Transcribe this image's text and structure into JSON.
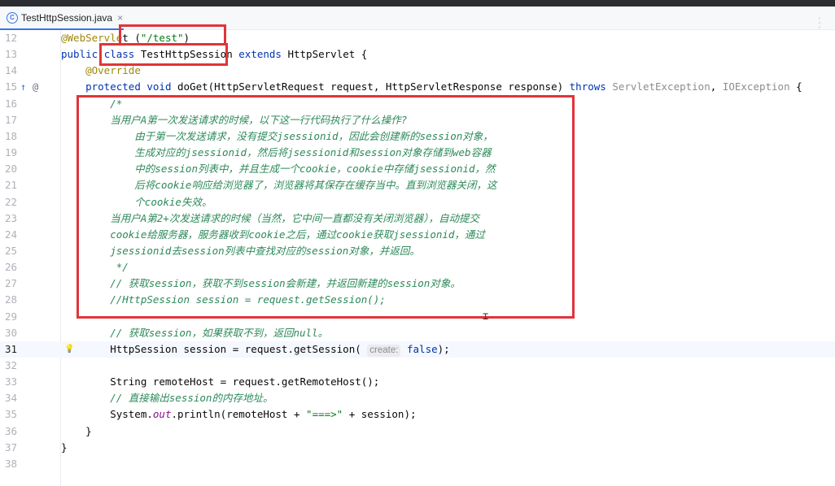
{
  "tab": {
    "filename": "TestHttpSession.java",
    "close": "×",
    "icon_letter": "C"
  },
  "lines": [
    {
      "n": "12",
      "parts": [
        [
          "ann",
          "@WebServle"
        ],
        [
          "",
          "t "
        ],
        [
          "",
          "("
        ],
        [
          "str",
          "\"/test\""
        ],
        [
          "",
          ")"
        ]
      ]
    },
    {
      "n": "13",
      "parts": [
        [
          "kw",
          "public "
        ],
        [
          "kw",
          "class "
        ],
        [
          "",
          "TestHttpSession "
        ],
        [
          "kw",
          "extends "
        ],
        [
          "",
          "HttpServlet {"
        ]
      ]
    },
    {
      "n": "14",
      "parts": [
        [
          "",
          "    "
        ],
        [
          "ann",
          "@Override"
        ]
      ]
    },
    {
      "n": "15",
      "parts": [
        [
          "",
          "    "
        ],
        [
          "kw",
          "protected void "
        ],
        [
          "",
          "doGet(HttpServletRequest request, HttpServletResponse response) "
        ],
        [
          "kw",
          "throws "
        ],
        [
          "gray",
          "ServletException"
        ],
        [
          "",
          ", "
        ],
        [
          "gray",
          "IOException"
        ],
        [
          "",
          " {"
        ]
      ]
    },
    {
      "n": "16",
      "parts": [
        [
          "cm",
          "        /*"
        ]
      ]
    },
    {
      "n": "17",
      "parts": [
        [
          "cm",
          "        当用户A第一次发送请求的时候，以下这一行代码执行了什么操作?"
        ]
      ]
    },
    {
      "n": "18",
      "parts": [
        [
          "cm",
          "            由于第一次发送请求，没有提交jsessionid，因此会创建新的session对象，"
        ]
      ]
    },
    {
      "n": "19",
      "parts": [
        [
          "cm",
          "            生成对应的jsessionid，然后将jsessionid和session对象存储到web容器"
        ]
      ]
    },
    {
      "n": "20",
      "parts": [
        [
          "cm",
          "            中的session列表中，并且生成一个cookie，cookie中存储jsessionid，然"
        ]
      ]
    },
    {
      "n": "21",
      "parts": [
        [
          "cm",
          "            后将cookie响应给浏览器了，浏览器将其保存在缓存当中。直到浏览器关闭，这"
        ]
      ]
    },
    {
      "n": "22",
      "parts": [
        [
          "cm",
          "            个cookie失效。"
        ]
      ]
    },
    {
      "n": "23",
      "parts": [
        [
          "cm",
          "        当用户A第2+次发送请求的时候（当然，它中间一直都没有关闭浏览器），自动提交"
        ]
      ]
    },
    {
      "n": "24",
      "parts": [
        [
          "cm",
          "        cookie给服务器，服务器收到cookie之后，通过cookie获取jsessionid，通过"
        ]
      ]
    },
    {
      "n": "25",
      "parts": [
        [
          "cm",
          "        jsessionid去session列表中查找对应的session对象，并返回。"
        ]
      ]
    },
    {
      "n": "26",
      "parts": [
        [
          "cm",
          "         */"
        ]
      ]
    },
    {
      "n": "27",
      "parts": [
        [
          "cm",
          "        // 获取session，获取不到session会新建，并返回新建的session对象。"
        ]
      ]
    },
    {
      "n": "28",
      "parts": [
        [
          "cm",
          "        //HttpSession session = request.getSession();"
        ]
      ]
    },
    {
      "n": "29",
      "parts": []
    },
    {
      "n": "30",
      "parts": [
        [
          "cm",
          "        // 获取session，如果获取不到，返回null。"
        ]
      ]
    },
    {
      "n": "31",
      "parts": [
        [
          "",
          "        HttpSession session = request.getSession( "
        ],
        [
          "hint",
          "create:"
        ],
        [
          "",
          " "
        ],
        [
          "kw",
          "false"
        ],
        [
          "",
          ");"
        ]
      ]
    },
    {
      "n": "32",
      "parts": []
    },
    {
      "n": "33",
      "parts": [
        [
          "",
          "        String remoteHost = request.getRemoteHost();"
        ]
      ]
    },
    {
      "n": "34",
      "parts": [
        [
          "cm",
          "        // 直接输出session的内存地址。"
        ]
      ]
    },
    {
      "n": "35",
      "parts": [
        [
          "",
          "        System."
        ],
        [
          "field",
          "out"
        ],
        [
          "",
          ".println(remoteHost + "
        ],
        [
          "str",
          "\"===>\""
        ],
        [
          "",
          " + session);"
        ]
      ]
    },
    {
      "n": "36",
      "parts": [
        [
          "",
          "    }"
        ]
      ]
    },
    {
      "n": "37",
      "parts": [
        [
          "",
          "}"
        ]
      ]
    },
    {
      "n": "38",
      "parts": []
    }
  ],
  "current_line": "31",
  "gutter": {
    "override_icon": "↑",
    "at_icon": "@",
    "bulb_icon": "💡"
  }
}
